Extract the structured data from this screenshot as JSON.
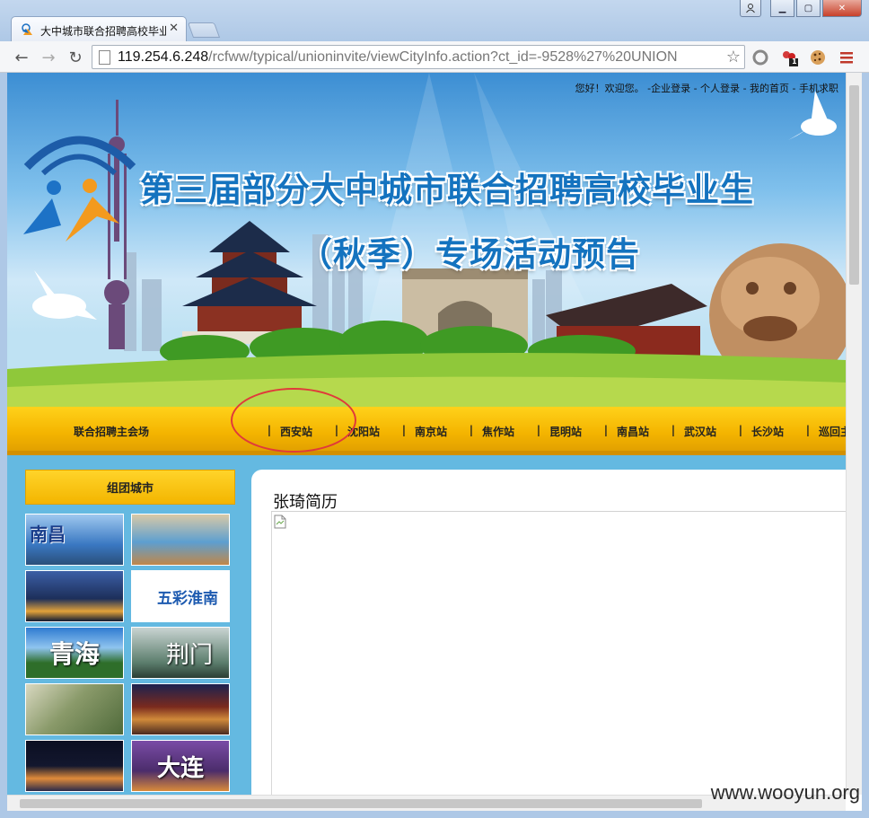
{
  "browser": {
    "ghost_title": "",
    "tab": {
      "title": "大中城市联合招聘高校毕业",
      "close_icon": "close-icon"
    },
    "url": {
      "host": "119.254.6.248",
      "path": "/rcfww/typical/unioninvite/viewCityInfo.action?ct_id=-9528%27%20UNION"
    },
    "icons": [
      "back-icon",
      "forward-icon",
      "reload-icon",
      "page-icon",
      "star-icon",
      "extension-icon",
      "cookie-icon",
      "menu-icon"
    ],
    "extension_badge": "1"
  },
  "site": {
    "topnav": {
      "greeting": "您好！欢迎您。",
      "links": [
        "-企业登录",
        "- 个人登录",
        "- 我的首页",
        "- 手机求职"
      ]
    },
    "banner": {
      "line1": "第三届部分大中城市联合招聘高校毕业生",
      "line2": "（秋季）专场活动预告"
    },
    "nav": {
      "main": "联合招聘主会场",
      "separator": "|",
      "items": [
        "西安站",
        "沈阳站",
        "南京站",
        "焦作站",
        "昆明站",
        "南昌站",
        "武汉站",
        "长沙站",
        "巡回主会"
      ]
    },
    "sidebar": {
      "title": "组团城市",
      "thumbs": [
        {
          "label": "南昌",
          "color": "#3a78c2"
        },
        {
          "label": "",
          "color": "#5d9fd0"
        },
        {
          "label": "",
          "color": "#1d2f5a"
        },
        {
          "label": "五彩淮南",
          "color": "#ffffff"
        },
        {
          "label": "青海",
          "color": "#2e6e2a"
        },
        {
          "label": "荆门",
          "color": "#5b7d6c"
        },
        {
          "label": "",
          "color": "#8a9a6a"
        },
        {
          "label": "",
          "color": "#7a2a1e"
        },
        {
          "label": "",
          "color": "#13172e"
        },
        {
          "label": "大连",
          "color": "#4b2c6b"
        }
      ]
    },
    "main": {
      "title": "张琦简历"
    }
  },
  "watermark": "www.wooyun.org",
  "colors": {
    "nav_yellow": "#f4b400",
    "page_blue": "#64b9e1",
    "headline_blue": "#1473bf",
    "annotation_red": "#e03a3a"
  }
}
